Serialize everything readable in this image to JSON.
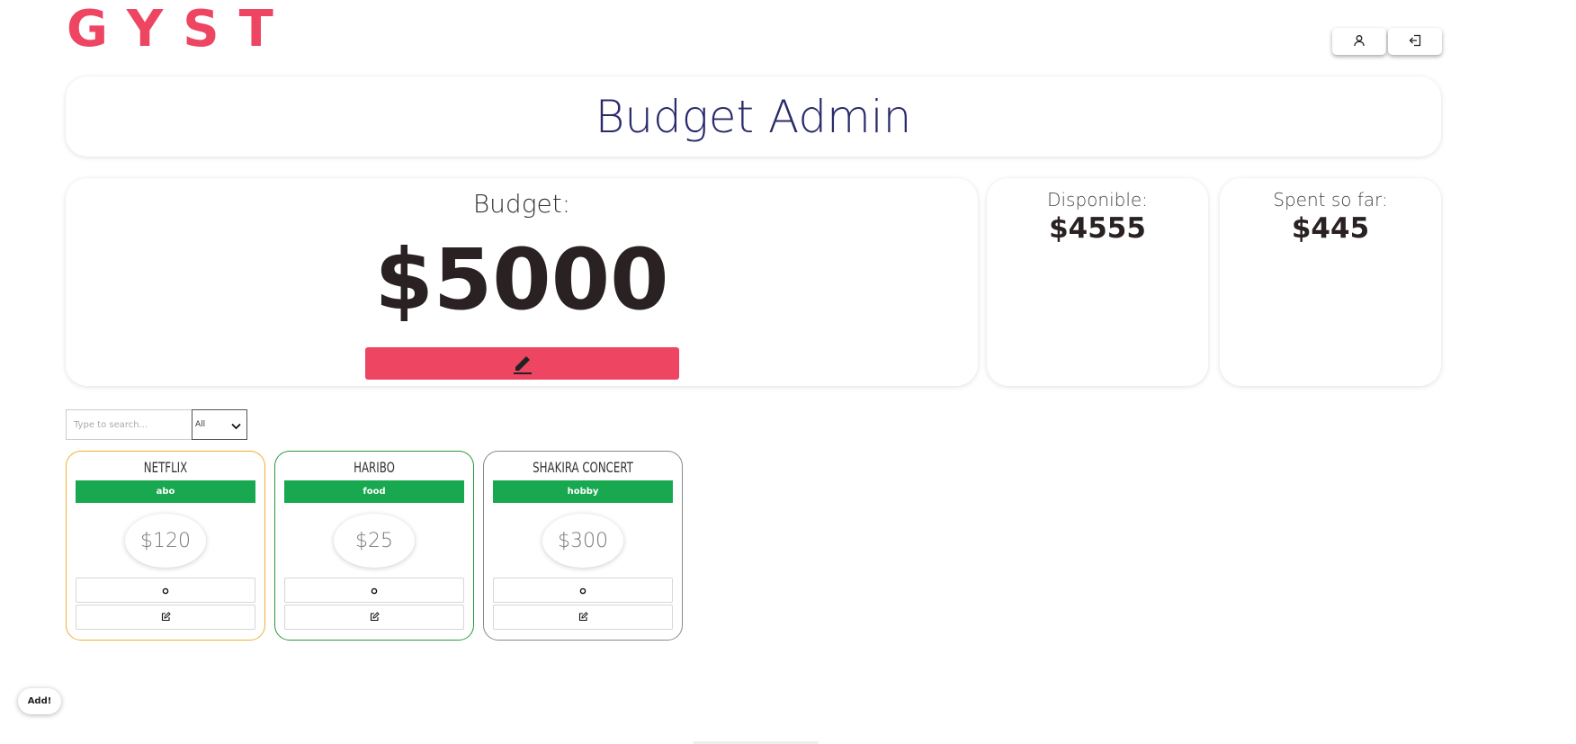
{
  "header": {
    "logo": "GYST"
  },
  "page": {
    "title": "Budget Admin"
  },
  "budget": {
    "label": "Budget:",
    "value": "$5000"
  },
  "stats": {
    "available_label": "Disponible:",
    "available_value": "$4555",
    "spent_label": "Spent so far:",
    "spent_value": "$445"
  },
  "filters": {
    "search_placeholder": "Type to search...",
    "category_selected": "All"
  },
  "expenses": [
    {
      "name": "NETFLIX",
      "category": "abo",
      "amount": "$120",
      "border_color": "#f0b030"
    },
    {
      "name": "HARIBO",
      "category": "food",
      "amount": "$25",
      "border_color": "#2a9a3a"
    },
    {
      "name": "SHAKIRA CONCERT",
      "category": "hobby",
      "amount": "$300",
      "border_color": "#8a8a8a"
    }
  ],
  "add_button": "Add!",
  "colors": {
    "brand": "#ee4563",
    "title": "#2a2a6c",
    "badge": "#18a84f"
  }
}
